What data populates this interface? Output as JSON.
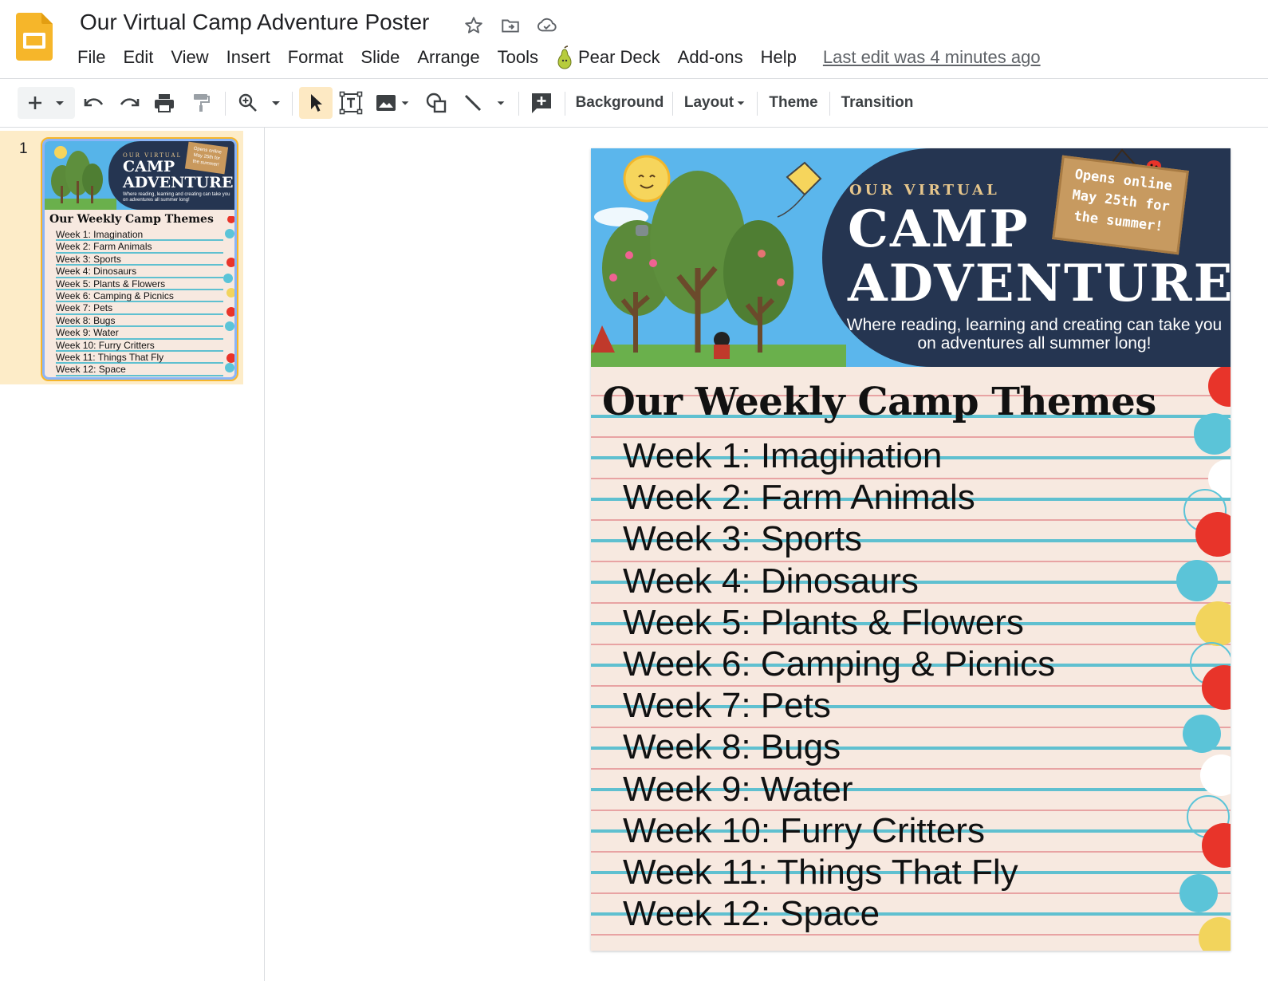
{
  "app": {
    "document_title": "Our Virtual Camp Adventure Poster",
    "last_edit": "Last edit was 4 minutes ago",
    "brand_color": "#f6b62a"
  },
  "menu": {
    "items": [
      "File",
      "Edit",
      "View",
      "Insert",
      "Format",
      "Slide",
      "Arrange",
      "Tools",
      "Pear Deck",
      "Add-ons",
      "Help"
    ]
  },
  "toolbar": {
    "background_label": "Background",
    "layout_label": "Layout",
    "theme_label": "Theme",
    "transition_label": "Transition"
  },
  "filmstrip": {
    "slide_number": "1"
  },
  "slide": {
    "banner_small": "OUR VIRTUAL",
    "banner_line1": "CAMP",
    "banner_line2": "ADVENTURE",
    "tagline": "Where reading, learning and creating can take you on adventures all summer long!",
    "sign_text": [
      "Opens online",
      "May 25th for",
      "the summer!"
    ],
    "heading": "Our Weekly Camp Themes",
    "weeks": [
      "Week 1: Imagination",
      "Week 2: Farm Animals",
      "Week 3: Sports",
      "Week 4: Dinosaurs",
      "Week 5: Plants & Flowers",
      "Week 6: Camping & Picnics",
      "Week 7: Pets",
      "Week 8: Bugs",
      "Week 9: Water",
      "Week 10: Furry Critters",
      "Week 11: Things That Fly",
      "Week 12: Space"
    ],
    "colors": {
      "navy": "#253551",
      "sky": "#5bb6ec",
      "paper": "#f7e9e0",
      "line_blue": "#5fc0d0",
      "line_red": "#e8a3a3",
      "dot_red": "#e8342a",
      "dot_blue": "#5bc4d8",
      "dot_yellow": "#f2d45c"
    }
  }
}
